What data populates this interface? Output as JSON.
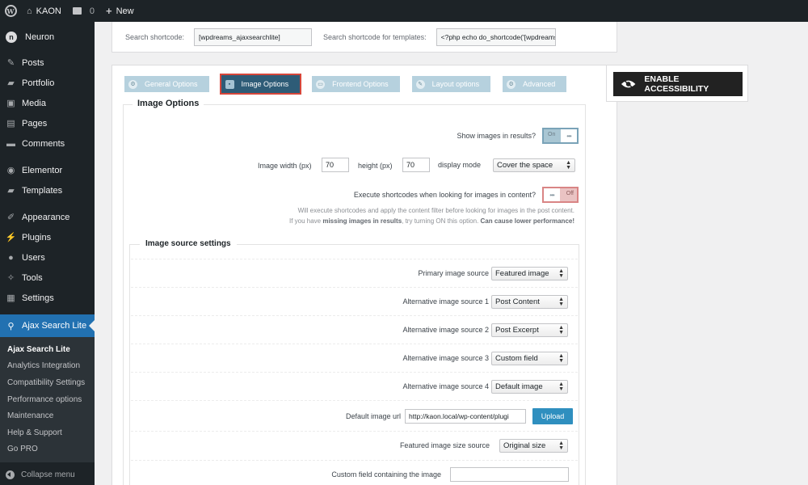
{
  "adminbar": {
    "site_name": "KAON",
    "comments_count": "0",
    "new_label": "New"
  },
  "sidebar": {
    "brand": "Neuron",
    "items": [
      {
        "label": "Posts",
        "icon": "pin-icon"
      },
      {
        "label": "Portfolio",
        "icon": "folder-icon"
      },
      {
        "label": "Media",
        "icon": "media-icon"
      },
      {
        "label": "Pages",
        "icon": "pages-icon"
      },
      {
        "label": "Comments",
        "icon": "comments-icon"
      },
      {
        "label": "Elementor",
        "icon": "elementor-icon"
      },
      {
        "label": "Templates",
        "icon": "templates-icon"
      },
      {
        "label": "Appearance",
        "icon": "brush-icon"
      },
      {
        "label": "Plugins",
        "icon": "plugin-icon"
      },
      {
        "label": "Users",
        "icon": "user-icon"
      },
      {
        "label": "Tools",
        "icon": "wrench-icon"
      },
      {
        "label": "Settings",
        "icon": "settings-icon"
      }
    ],
    "active": "Ajax Search Lite",
    "submenu": [
      "Ajax Search Lite",
      "Analytics Integration",
      "Compatibility Settings",
      "Performance options",
      "Maintenance",
      "Help & Support",
      "Go PRO"
    ],
    "collapse": "Collapse menu"
  },
  "shortcode": {
    "label1": "Search shortcode:",
    "value1": "[wpdreams_ajaxsearchlite]",
    "label2": "Search shortcode for templates:",
    "value2": "<?php echo do_shortcode('[wpdreams"
  },
  "tabs": [
    "General Options",
    "Image Options",
    "Frontend Options",
    "Layout options",
    "Advanced"
  ],
  "image_options": {
    "legend": "Image Options",
    "show_images_label": "Show images in results?",
    "show_images_toggle": "On",
    "width_label": "Image width (px)",
    "width_value": "70",
    "height_label": "height (px)",
    "height_value": "70",
    "display_mode_label": "display mode",
    "display_mode_value": "Cover the space",
    "exec_shortcodes_label": "Execute shortcodes when looking for images in content?",
    "exec_shortcodes_toggle": "Off",
    "note_line1": "Will execute shortcodes and apply the content filter before looking for images in the post content.",
    "note_line2_pre": "If you have ",
    "note_line2_bold1": "missing images in results",
    "note_line2_mid": ", try turning ON this option. ",
    "note_line2_bold2": "Can cause lower performance!"
  },
  "image_source": {
    "legend": "Image source settings",
    "rows": [
      {
        "label": "Primary image source",
        "value": "Featured image"
      },
      {
        "label": "Alternative image source 1",
        "value": "Post Content"
      },
      {
        "label": "Alternative image source 2",
        "value": "Post Excerpt"
      },
      {
        "label": "Alternative image source 3",
        "value": "Custom field"
      },
      {
        "label": "Alternative image source 4",
        "value": "Default image"
      }
    ],
    "default_url_label": "Default image url",
    "default_url_value": "http://kaon.local/wp-content/plugi",
    "upload_label": "Upload",
    "size_label": "Featured image size source",
    "size_value": "Original size",
    "custom_field_label": "Custom field containing the image",
    "custom_field_value": ""
  },
  "accessibility": {
    "label": "ENABLE ACCESSIBILITY"
  }
}
